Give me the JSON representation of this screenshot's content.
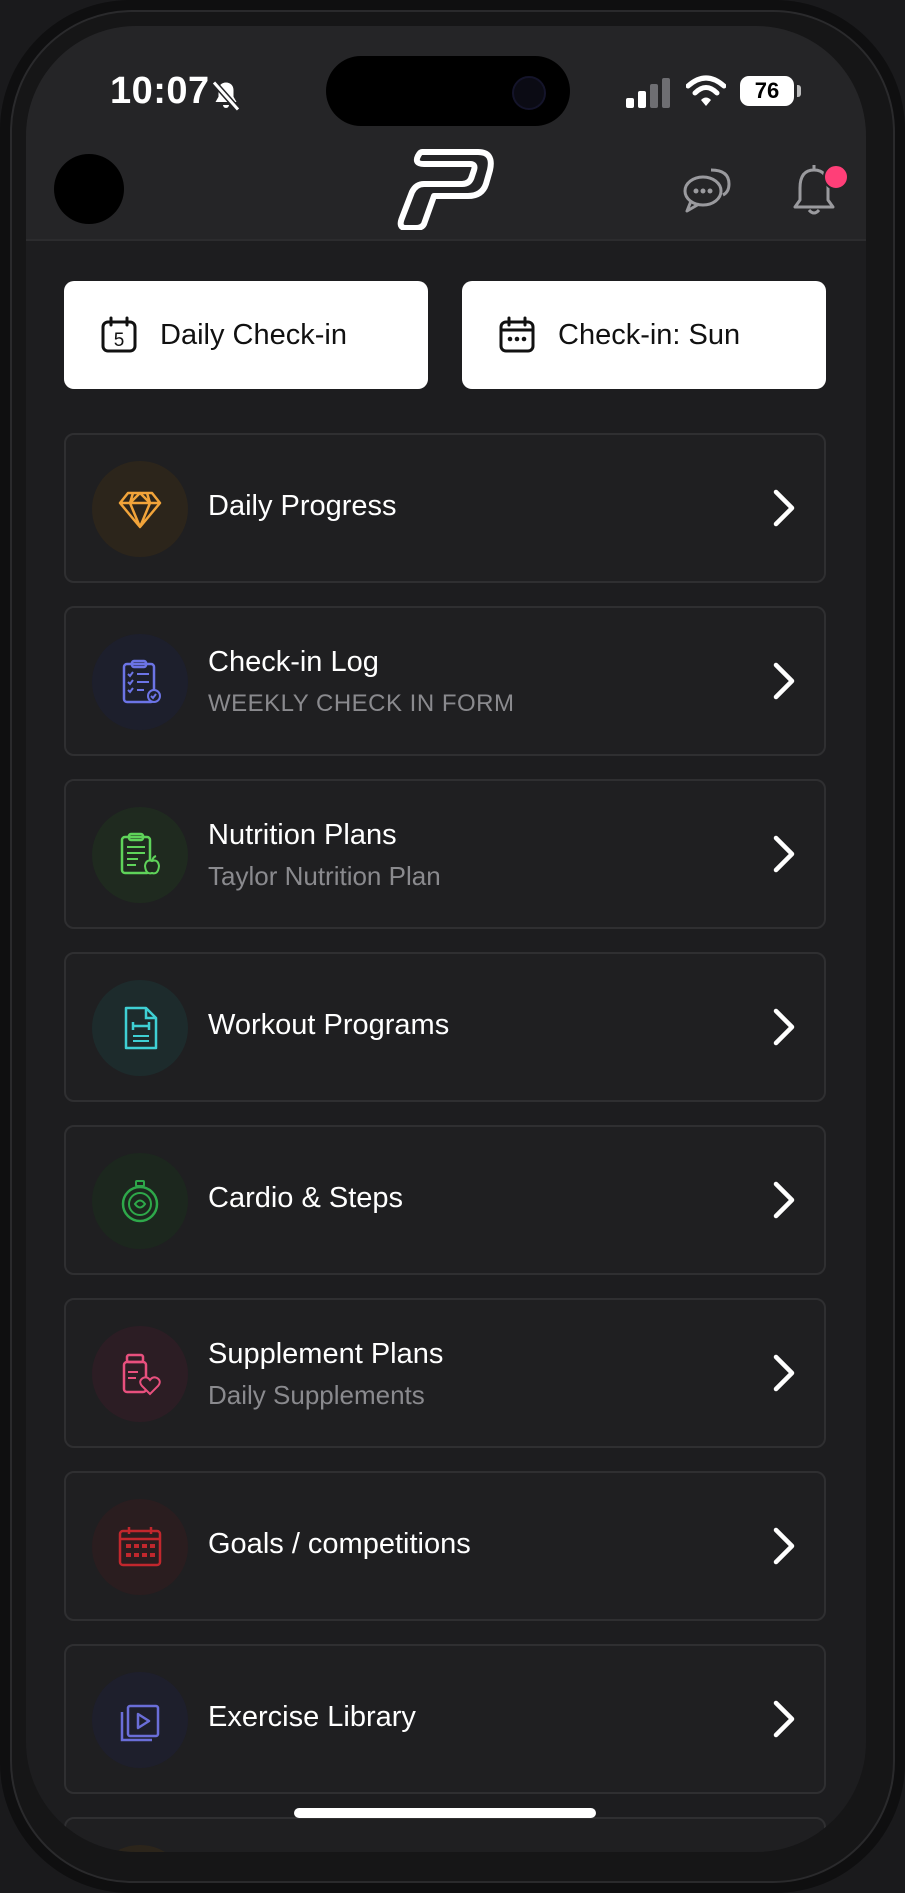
{
  "status_bar": {
    "time": "10:07",
    "battery": "76"
  },
  "header": {
    "logo_icon": "brand-p-logo",
    "chat_icon": "chat-bubbles-icon",
    "bell_icon": "bell-icon",
    "notification_dot_color": "#ff3f78"
  },
  "quick_actions": [
    {
      "label": "Daily Check-in",
      "icon": "calendar-day-5-icon",
      "icon_number": "5"
    },
    {
      "label": "Check-in: Sun",
      "icon": "calendar-icon"
    }
  ],
  "menu": [
    {
      "title": "Daily Progress",
      "subtitle": "",
      "icon": "diamond-icon",
      "color": "#f2a43a"
    },
    {
      "title": "Check-in Log",
      "subtitle": "WEEKLY CHECK IN FORM",
      "icon": "checklist-clipboard-icon",
      "color": "#6c74e6"
    },
    {
      "title": "Nutrition Plans",
      "subtitle": "Taylor Nutrition Plan",
      "icon": "nutrition-clipboard-icon",
      "color": "#5fd35a"
    },
    {
      "title": "Workout Programs",
      "subtitle": "",
      "icon": "workout-document-icon",
      "color": "#3fd0d4"
    },
    {
      "title": "Cardio & Steps",
      "subtitle": "",
      "icon": "stopwatch-icon",
      "color": "#2ea84a"
    },
    {
      "title": "Supplement Plans",
      "subtitle": "Daily Supplements",
      "icon": "supplement-bottle-icon",
      "color": "#e8507e"
    },
    {
      "title": "Goals / competitions",
      "subtitle": "",
      "icon": "calendar-goals-icon",
      "color": "#c1272d"
    },
    {
      "title": "Exercise Library",
      "subtitle": "",
      "icon": "video-library-icon",
      "color": "#6a6ed8"
    }
  ]
}
